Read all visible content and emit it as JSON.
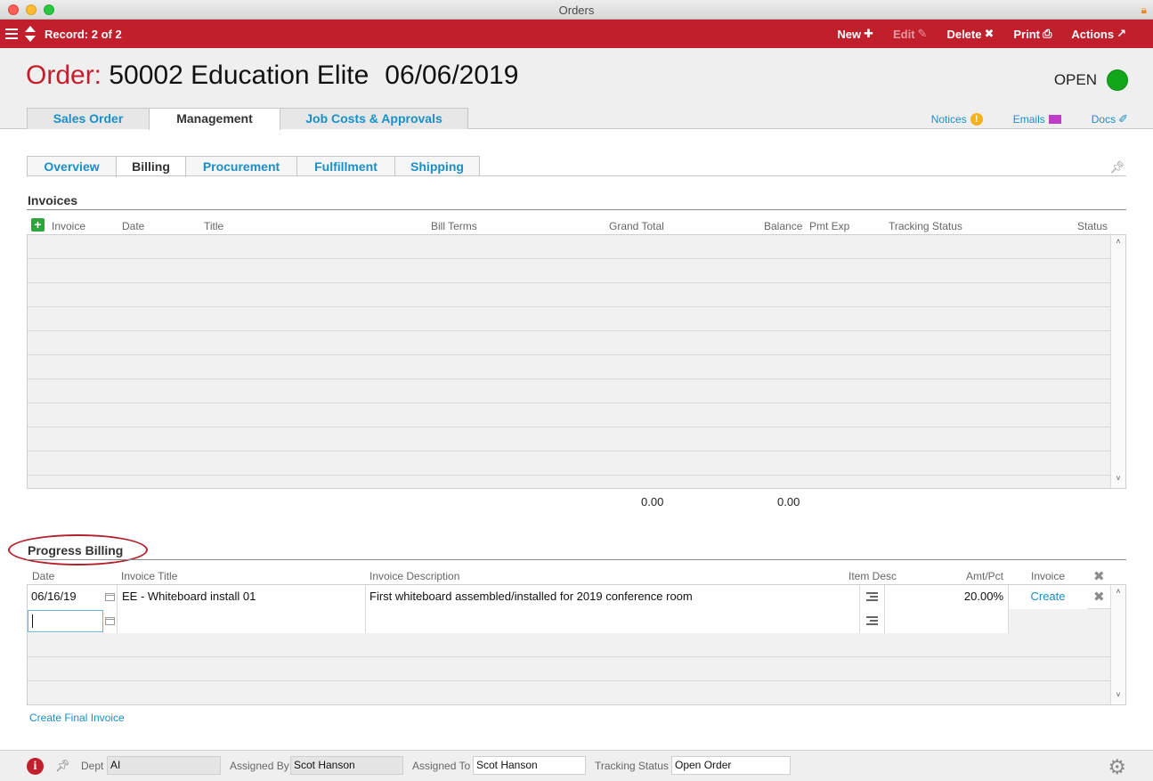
{
  "window": {
    "title": "Orders"
  },
  "toolbar": {
    "record": "Record: 2 of 2",
    "buttons": [
      {
        "label": "New",
        "icon": "plus-icon",
        "enabled": true
      },
      {
        "label": "Edit",
        "icon": "pencil-icon",
        "enabled": false
      },
      {
        "label": "Delete",
        "icon": "x-icon",
        "enabled": true
      },
      {
        "label": "Print",
        "icon": "printer-icon",
        "enabled": true
      },
      {
        "label": "Actions",
        "icon": "arrow-out-icon",
        "enabled": true
      }
    ]
  },
  "header": {
    "label": "Order:",
    "number_name": "50002 Education Elite",
    "date": "06/06/2019",
    "status": "OPEN",
    "status_color": "#12a61b"
  },
  "main_tabs": [
    "Sales Order",
    "Management",
    "Job Costs & Approvals"
  ],
  "main_tab_active": "Management",
  "quick_links": [
    {
      "label": "Notices",
      "icon": "warning-icon"
    },
    {
      "label": "Emails",
      "icon": "envelope-icon"
    },
    {
      "label": "Docs",
      "icon": "paperclip-icon"
    }
  ],
  "sub_tabs": [
    "Overview",
    "Billing",
    "Procurement",
    "Fulfillment",
    "Shipping"
  ],
  "sub_tab_active": "Billing",
  "invoices": {
    "title": "Invoices",
    "columns": [
      "Invoice",
      "Date",
      "Title",
      "Bill Terms",
      "Grand Total",
      "Balance",
      "Pmt Exp",
      "Tracking Status",
      "Status"
    ],
    "rows": [],
    "grand_total_sum": "0.00",
    "balance_sum": "0.00"
  },
  "progress_billing": {
    "title": "Progress Billing",
    "columns": [
      "Date",
      "Invoice Title",
      "Invoice Description",
      "Item Desc",
      "Amt/Pct",
      "Invoice"
    ],
    "rows": [
      {
        "date": "06/16/19",
        "title": "EE - Whiteboard install 01",
        "description": "First whiteboard assembled/installed for 2019 conference room",
        "amount": "20.00%",
        "invoice_action": "Create"
      }
    ],
    "new_row_date": "",
    "final_invoice_link": "Create Final Invoice"
  },
  "footer": {
    "dept_label": "Dept",
    "dept_value": "AI",
    "assigned_by_label": "Assigned By",
    "assigned_by_value": "Scot Hanson",
    "assigned_to_label": "Assigned To",
    "assigned_to_value": "Scot Hanson",
    "tracking_label": "Tracking Status",
    "tracking_value": "Open Order"
  },
  "colors": {
    "brand": "#c21f2d",
    "link": "#1a8fc7",
    "add": "#2ea53a"
  }
}
